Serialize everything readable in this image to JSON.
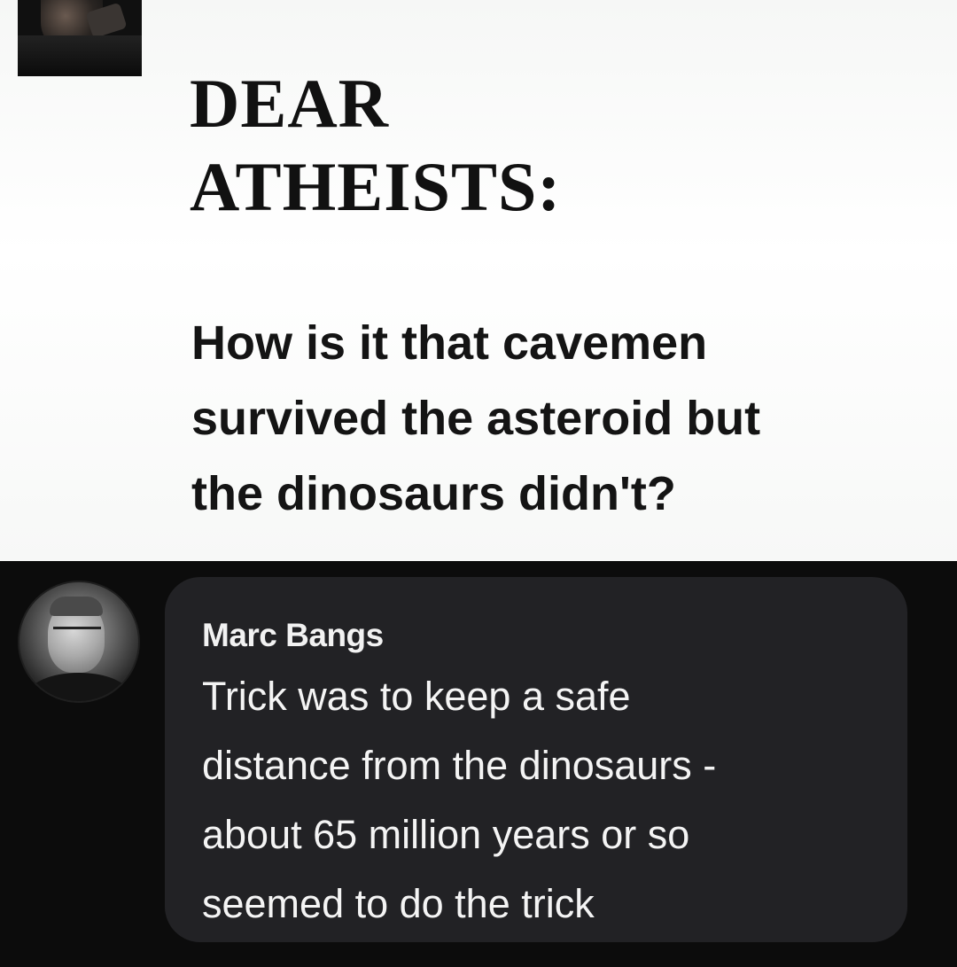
{
  "post": {
    "title": "DEAR\nATHEISTS:",
    "question": "How is it that cavemen\nsurvived the asteroid but\nthe dinosaurs didn't?"
  },
  "comment": {
    "author": "Marc Bangs",
    "text": "Trick was to keep a safe\ndistance from the dinosaurs -\nabout 65 million years or so\nseemed to do the trick"
  },
  "colors": {
    "post_background": "#ffffff",
    "comment_area_background": "#0c0c0c",
    "comment_bubble": "#222225",
    "comment_text": "#f4f4f4"
  }
}
